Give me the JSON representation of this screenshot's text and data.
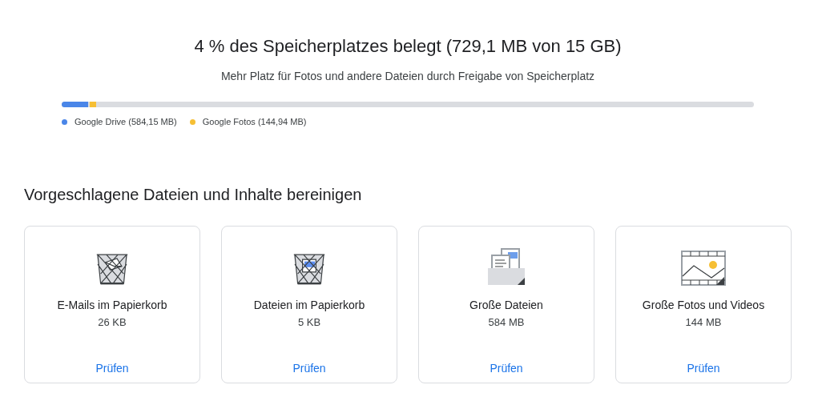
{
  "storage": {
    "title": "4 % des Speicherplatzes belegt (729,1 MB von 15 GB)",
    "subtitle": "Mehr Platz für Fotos und andere Dateien durch Freigabe von Speicherplatz",
    "bar_segments": [
      {
        "color": "#4a86e8",
        "level": 0.038
      },
      {
        "color": "#f6bf34",
        "level": 0.0097
      }
    ],
    "legend": [
      {
        "label": "Google Drive (584,15 MB)",
        "color": "#4a86e8"
      },
      {
        "label": "Google Fotos (144,94 MB)",
        "color": "#f6bf34"
      }
    ]
  },
  "cleanup": {
    "heading": "Vorgeschlagene Dateien und Inhalte bereinigen",
    "cards": [
      {
        "kind": "trash-mail",
        "title": "E-Mails im Papierkorb",
        "size": "26 KB",
        "action": "Prüfen"
      },
      {
        "kind": "trash-files",
        "title": "Dateien im Papierkorb",
        "size": "5 KB",
        "action": "Prüfen"
      },
      {
        "kind": "large-files",
        "title": "Große Dateien",
        "size": "584 MB",
        "action": "Prüfen"
      },
      {
        "kind": "large-media",
        "title": "Große Fotos und Videos",
        "size": "144 MB",
        "action": "Prüfen"
      }
    ]
  }
}
